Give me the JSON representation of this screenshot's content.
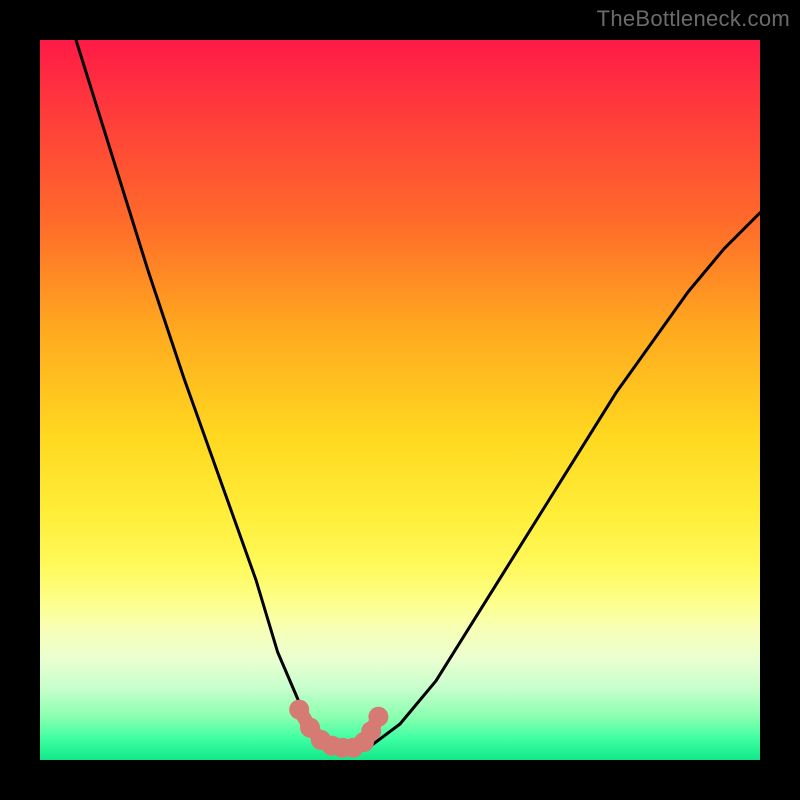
{
  "watermark": "TheBottleneck.com",
  "chart_data": {
    "type": "line",
    "title": "",
    "xlabel": "",
    "ylabel": "",
    "xlim": [
      0,
      100
    ],
    "ylim": [
      0,
      100
    ],
    "series": [
      {
        "name": "bottleneck-curve",
        "x": [
          5,
          10,
          15,
          20,
          25,
          30,
          33,
          36,
          38,
          40,
          42,
          44,
          46,
          50,
          55,
          60,
          65,
          70,
          75,
          80,
          85,
          90,
          95,
          100
        ],
        "values": [
          100,
          84,
          68,
          53,
          39,
          25,
          15,
          8,
          4,
          2,
          1,
          1,
          2,
          5,
          11,
          19,
          27,
          35,
          43,
          51,
          58,
          65,
          71,
          76
        ]
      }
    ],
    "markers": {
      "name": "highlight-dots",
      "x": [
        36,
        37.5,
        39,
        40.5,
        42,
        43.5,
        45,
        46,
        47
      ],
      "values": [
        7,
        4.5,
        2.8,
        2,
        1.7,
        1.7,
        2.5,
        4,
        6
      ]
    },
    "marker_color": "#d67a74",
    "curve_color": "#000000",
    "background": "rainbow-gradient"
  }
}
